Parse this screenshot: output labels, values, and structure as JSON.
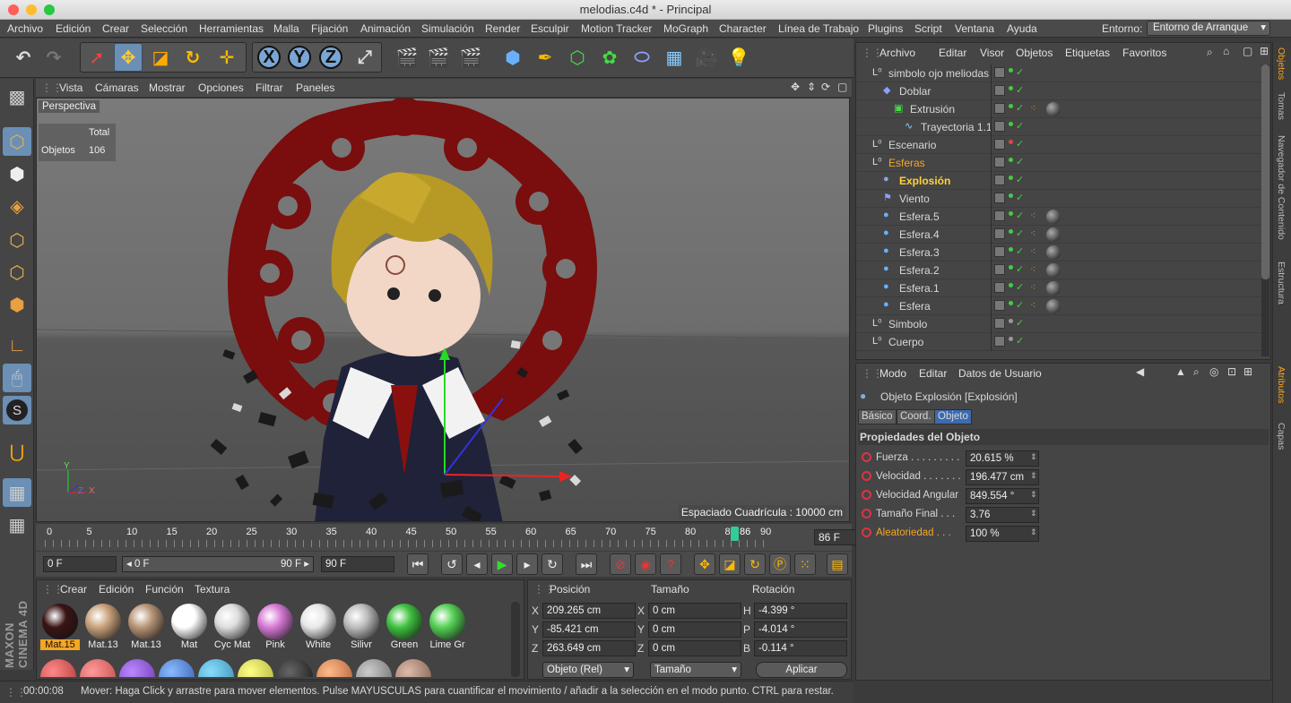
{
  "window": {
    "title": "melodias.c4d * - Principal"
  },
  "menu": [
    "Archivo",
    "Edición",
    "Crear",
    "Selección",
    "Herramientas",
    "Malla",
    "Fijación",
    "Animación",
    "Simulación",
    "Render",
    "Esculpir",
    "Motion Tracker",
    "MoGraph",
    "Character",
    "Línea de Trabajo",
    "Plugins",
    "Script",
    "Ventana",
    "Ayuda"
  ],
  "entorno": {
    "label": "Entorno:",
    "value": "Entorno de Arranque"
  },
  "viewport": {
    "menu": [
      "Vista",
      "Cámaras",
      "Mostrar",
      "Opciones",
      "Filtrar",
      "Paneles"
    ],
    "camera": "Perspectiva",
    "stats_header": "Total",
    "stats_label": "Objetos",
    "stats_value": "106",
    "grid_spacing": "Espaciado Cuadrícula : 10000 cm",
    "axis_y": "Y",
    "axis_x": "X",
    "axis_z": "Z"
  },
  "timeline": {
    "ticks": [
      "0",
      "5",
      "10",
      "15",
      "20",
      "25",
      "30",
      "35",
      "40",
      "45",
      "50",
      "55",
      "60",
      "65",
      "70",
      "75",
      "80",
      "85",
      "86",
      "90"
    ],
    "current_frame": "86 F",
    "start_field": "0 F",
    "range_start": "◂ 0 F",
    "range_end": "90 F ▸",
    "end_field": "90 F"
  },
  "materials": {
    "menu": [
      "Crear",
      "Edición",
      "Función",
      "Textura"
    ],
    "items": [
      {
        "name": "Mat.15",
        "color": "#3a1414"
      },
      {
        "name": "Mat.13",
        "color": "#c9a27c"
      },
      {
        "name": "Mat.13",
        "color": "#b89577"
      },
      {
        "name": "Mat",
        "color": "#ffffff"
      },
      {
        "name": "Cyc Mat",
        "color": "#dddddd"
      },
      {
        "name": "Pink",
        "color": "#d77ad6"
      },
      {
        "name": "White",
        "color": "#e8e8e8"
      },
      {
        "name": "Silivr",
        "color": "#bdbdbd"
      },
      {
        "name": "Green",
        "color": "#3fc23f"
      },
      {
        "name": "Lime Gr",
        "color": "#55d155"
      }
    ]
  },
  "coords": {
    "headers": [
      "Posición",
      "Tamaño",
      "Rotación"
    ],
    "rows": [
      {
        "pl": "X",
        "pv": "209.265 cm",
        "sl": "X",
        "sv": "0 cm",
        "rl": "H",
        "rv": "-4.399 °"
      },
      {
        "pl": "Y",
        "pv": "-85.421 cm",
        "sl": "Y",
        "sv": "0 cm",
        "rl": "P",
        "rv": "-4.014 °"
      },
      {
        "pl": "Z",
        "pv": "263.649 cm",
        "sl": "Z",
        "sv": "0 cm",
        "rl": "B",
        "rv": "-0.114 °"
      }
    ],
    "mode": "Objeto (Rel)",
    "size_mode": "Tamaño",
    "apply": "Aplicar"
  },
  "status": {
    "time": "00:00:08",
    "text": "Mover: Haga Click y arrastre para mover elementos. Pulse MAYUSCULAS para cuantificar el movimiento / añadir a la selección en el modo punto. CTRL para restar."
  },
  "objects": {
    "menu": [
      "Archivo",
      "Editar",
      "Visor",
      "Objetos",
      "Etiquetas",
      "Favoritos"
    ],
    "items": [
      {
        "name": "simbolo ojo meliodas",
        "indent": 0,
        "dot": "#4c4",
        "icon": "null"
      },
      {
        "name": "Doblar",
        "indent": 1,
        "dot": "#4c4",
        "icon": "deform"
      },
      {
        "name": "Extrusión",
        "indent": 2,
        "dot": "#4c4",
        "icon": "extrude"
      },
      {
        "name": "Trayectoria 1.1",
        "indent": 3,
        "dot": "#4c4",
        "icon": "spline"
      },
      {
        "name": "Escenario",
        "indent": 0,
        "dot": "#d44",
        "icon": "null"
      },
      {
        "name": "Esferas",
        "indent": 0,
        "dot": "#4c4",
        "icon": "null",
        "highlight": "orange"
      },
      {
        "name": "Explosión",
        "indent": 1,
        "dot": "#4c4",
        "icon": "explode",
        "highlight": "yellow"
      },
      {
        "name": "Viento",
        "indent": 1,
        "dot": "#4c4",
        "icon": "wind"
      },
      {
        "name": "Esfera.5",
        "indent": 1,
        "dot": "#4c4",
        "icon": "sphere"
      },
      {
        "name": "Esfera.4",
        "indent": 1,
        "dot": "#4c4",
        "icon": "sphere"
      },
      {
        "name": "Esfera.3",
        "indent": 1,
        "dot": "#4c4",
        "icon": "sphere"
      },
      {
        "name": "Esfera.2",
        "indent": 1,
        "dot": "#4c4",
        "icon": "sphere"
      },
      {
        "name": "Esfera.1",
        "indent": 1,
        "dot": "#4c4",
        "icon": "sphere"
      },
      {
        "name": "Esfera",
        "indent": 1,
        "dot": "#4c4",
        "icon": "sphere"
      },
      {
        "name": "Simbolo",
        "indent": 0,
        "dot": "#999",
        "icon": "null"
      },
      {
        "name": "Cuerpo",
        "indent": 0,
        "dot": "#999",
        "icon": "null"
      }
    ]
  },
  "attributes": {
    "menu": [
      "Modo",
      "Editar",
      "Datos de Usuario"
    ],
    "object_title": "Objeto Explosión  [Explosión]",
    "tabs": [
      "Básico",
      "Coord.",
      "Objeto"
    ],
    "section": "Propiedades del Objeto",
    "props": [
      {
        "label": "Fuerza . . . . . . . . .",
        "value": "20.615 %"
      },
      {
        "label": "Velocidad . . . . . . .",
        "value": "196.477 cm"
      },
      {
        "label": "Velocidad Angular",
        "value": "849.554 °"
      },
      {
        "label": "Tamaño Final . . .",
        "value": "3.76"
      },
      {
        "label": "Aleatoriedad . . .",
        "value": "100 %",
        "highlight": true
      }
    ]
  },
  "right_tabs": [
    "Objetos",
    "Tomas",
    "Navegador de Contenido",
    "Estructura",
    "Atributos",
    "Capas"
  ],
  "brand": "MAXON CINEMA 4D"
}
